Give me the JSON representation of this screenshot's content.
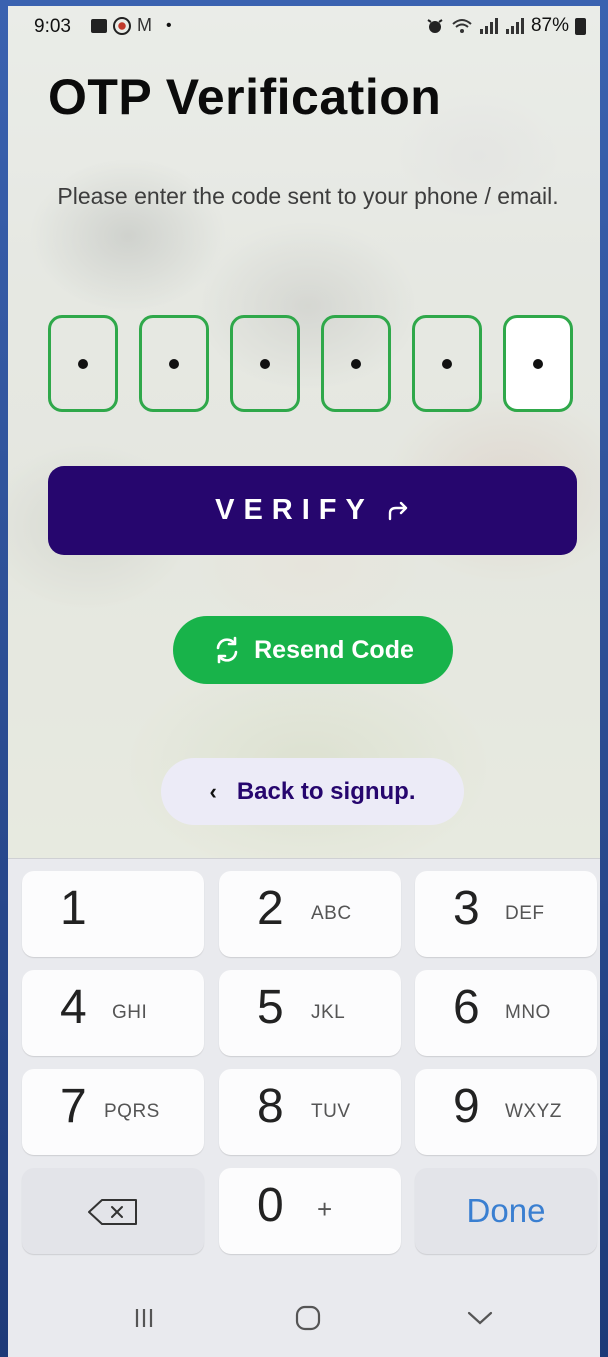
{
  "status_bar": {
    "time": "9:03",
    "battery": "87%",
    "icons": [
      "gallery-icon",
      "record-icon",
      "gmail-icon",
      "dot-icon",
      "alarm-icon",
      "wifi-icon",
      "signal-icon",
      "signal-icon",
      "battery-icon"
    ]
  },
  "page": {
    "title": "OTP Verification",
    "subtitle": "Please enter the code sent to your phone / email."
  },
  "otp": {
    "digits": [
      "•",
      "•",
      "•",
      "•",
      "•",
      "•"
    ],
    "accent": "#2fa84a"
  },
  "buttons": {
    "verify": "VERIFY",
    "resend": "Resend Code",
    "back": "Back to signup."
  },
  "colors": {
    "primary": "#26066e",
    "success": "#18b34a",
    "back_bg": "#ecebf7",
    "done": "#3a7fd1"
  },
  "keyboard": {
    "keys": [
      {
        "num": "1",
        "letters": ""
      },
      {
        "num": "2",
        "letters": "ABC"
      },
      {
        "num": "3",
        "letters": "DEF"
      },
      {
        "num": "4",
        "letters": "GHI"
      },
      {
        "num": "5",
        "letters": "JKL"
      },
      {
        "num": "6",
        "letters": "MNO"
      },
      {
        "num": "7",
        "letters": "PQRS"
      },
      {
        "num": "8",
        "letters": "TUV"
      },
      {
        "num": "9",
        "letters": "WXYZ"
      },
      {
        "num": "0",
        "letters": "+"
      }
    ],
    "done": "Done"
  },
  "nav": [
    "recent-apps-icon",
    "home-icon",
    "back-chevron-icon"
  ]
}
